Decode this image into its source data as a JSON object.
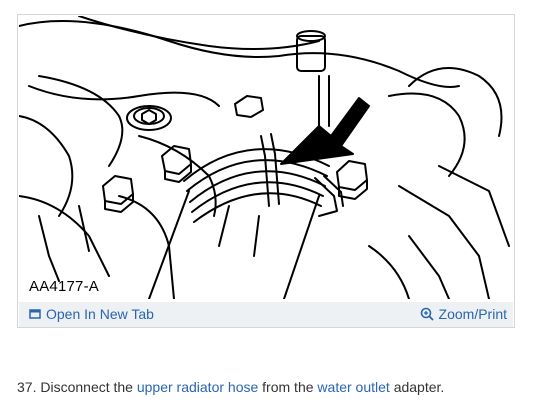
{
  "figure": {
    "id_label": "AA4177-A"
  },
  "actions": {
    "open_new_tab": "Open In New Tab",
    "zoom_print": "Zoom/Print"
  },
  "step": {
    "number": "37.",
    "text_before": "Disconnect the",
    "link1": "upper radiator hose",
    "text_middle": "from the",
    "link2": "water outlet",
    "text_after": "adapter."
  },
  "colors": {
    "link": "#2a65b0",
    "action_bar_bg": "#eef1f4",
    "border": "#d6d6d6"
  },
  "icons": {
    "open_new_tab": "external-window-icon",
    "zoom_print": "magnifier-plus-icon"
  }
}
